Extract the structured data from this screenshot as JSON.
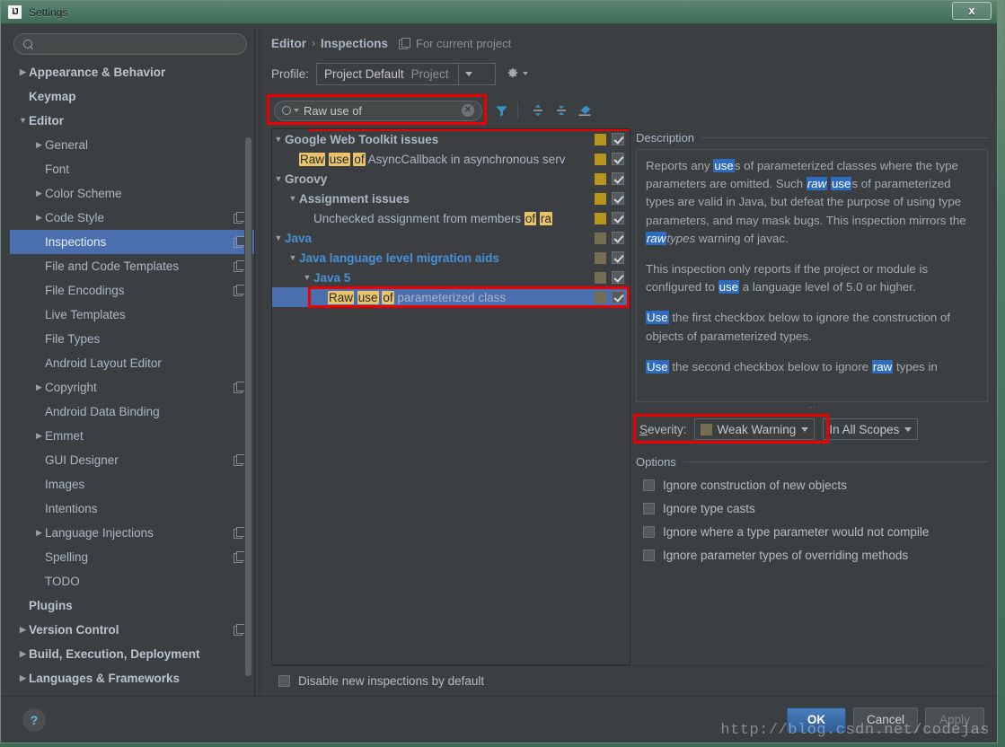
{
  "window": {
    "title": "Settings",
    "app_icon": "intellij-idea-icon",
    "close_label": "x"
  },
  "sidebar": {
    "search": {
      "placeholder": "",
      "value": "",
      "icon": "search-icon"
    },
    "items": [
      {
        "label": "Appearance & Behavior",
        "indent": 0,
        "arrow": "collapsed",
        "bold": true,
        "badge": false,
        "selected": false
      },
      {
        "label": "Keymap",
        "indent": 0,
        "arrow": "none",
        "bold": true,
        "badge": false,
        "selected": false
      },
      {
        "label": "Editor",
        "indent": 0,
        "arrow": "expanded",
        "bold": true,
        "badge": false,
        "selected": false
      },
      {
        "label": "General",
        "indent": 1,
        "arrow": "collapsed",
        "bold": false,
        "badge": false,
        "selected": false
      },
      {
        "label": "Font",
        "indent": 1,
        "arrow": "none",
        "bold": false,
        "badge": false,
        "selected": false
      },
      {
        "label": "Color Scheme",
        "indent": 1,
        "arrow": "collapsed",
        "bold": false,
        "badge": false,
        "selected": false
      },
      {
        "label": "Code Style",
        "indent": 1,
        "arrow": "collapsed",
        "bold": false,
        "badge": true,
        "selected": false
      },
      {
        "label": "Inspections",
        "indent": 1,
        "arrow": "none",
        "bold": false,
        "badge": true,
        "selected": true
      },
      {
        "label": "File and Code Templates",
        "indent": 1,
        "arrow": "none",
        "bold": false,
        "badge": true,
        "selected": false
      },
      {
        "label": "File Encodings",
        "indent": 1,
        "arrow": "none",
        "bold": false,
        "badge": true,
        "selected": false
      },
      {
        "label": "Live Templates",
        "indent": 1,
        "arrow": "none",
        "bold": false,
        "badge": false,
        "selected": false
      },
      {
        "label": "File Types",
        "indent": 1,
        "arrow": "none",
        "bold": false,
        "badge": false,
        "selected": false
      },
      {
        "label": "Android Layout Editor",
        "indent": 1,
        "arrow": "none",
        "bold": false,
        "badge": false,
        "selected": false
      },
      {
        "label": "Copyright",
        "indent": 1,
        "arrow": "collapsed",
        "bold": false,
        "badge": true,
        "selected": false
      },
      {
        "label": "Android Data Binding",
        "indent": 1,
        "arrow": "none",
        "bold": false,
        "badge": false,
        "selected": false
      },
      {
        "label": "Emmet",
        "indent": 1,
        "arrow": "collapsed",
        "bold": false,
        "badge": false,
        "selected": false
      },
      {
        "label": "GUI Designer",
        "indent": 1,
        "arrow": "none",
        "bold": false,
        "badge": true,
        "selected": false
      },
      {
        "label": "Images",
        "indent": 1,
        "arrow": "none",
        "bold": false,
        "badge": false,
        "selected": false
      },
      {
        "label": "Intentions",
        "indent": 1,
        "arrow": "none",
        "bold": false,
        "badge": false,
        "selected": false
      },
      {
        "label": "Language Injections",
        "indent": 1,
        "arrow": "collapsed",
        "bold": false,
        "badge": true,
        "selected": false
      },
      {
        "label": "Spelling",
        "indent": 1,
        "arrow": "none",
        "bold": false,
        "badge": true,
        "selected": false
      },
      {
        "label": "TODO",
        "indent": 1,
        "arrow": "none",
        "bold": false,
        "badge": false,
        "selected": false
      },
      {
        "label": "Plugins",
        "indent": 0,
        "arrow": "none",
        "bold": true,
        "badge": false,
        "selected": false
      },
      {
        "label": "Version Control",
        "indent": 0,
        "arrow": "collapsed",
        "bold": true,
        "badge": true,
        "selected": false
      },
      {
        "label": "Build, Execution, Deployment",
        "indent": 0,
        "arrow": "collapsed",
        "bold": true,
        "badge": false,
        "selected": false
      },
      {
        "label": "Languages & Frameworks",
        "indent": 0,
        "arrow": "collapsed",
        "bold": true,
        "badge": false,
        "selected": false
      }
    ]
  },
  "main": {
    "breadcrumb": {
      "root": "Editor",
      "separator": "›",
      "leaf": "Inspections"
    },
    "scope_note": "For current project",
    "profile": {
      "label": "Profile:",
      "value": "Project Default",
      "suffix": "Project",
      "gear_icon": "gear-icon"
    },
    "toolbar": {
      "search_value": "Raw use of",
      "search_icon": "search-icon",
      "clear_icon": "clear-x-icon",
      "filter_icon": "filter-funnel-icon",
      "expand_icon": "expand-all-icon",
      "collapse_icon": "collapse-all-icon",
      "reset_icon": "eraser-icon"
    },
    "tree": [
      {
        "indent": 0,
        "arrow": "expanded",
        "style": "group",
        "parts": [
          {
            "t": "Google Web Toolkit issues",
            "h": false
          }
        ],
        "severity": "#b8941f",
        "checked": true,
        "selected": false
      },
      {
        "indent": 1,
        "arrow": "none",
        "style": "plain",
        "parts": [
          {
            "t": "Raw",
            "h": true
          },
          {
            "t": " ",
            "h": false
          },
          {
            "t": "use",
            "h": true
          },
          {
            "t": " ",
            "h": false
          },
          {
            "t": "of",
            "h": true
          },
          {
            "t": " AsyncCallback in asynchronous serv",
            "h": false
          }
        ],
        "severity": "#b8941f",
        "checked": true,
        "selected": false
      },
      {
        "indent": 0,
        "arrow": "expanded",
        "style": "group",
        "parts": [
          {
            "t": "Groovy",
            "h": false
          }
        ],
        "severity": "#b8941f",
        "checked": true,
        "selected": false
      },
      {
        "indent": 1,
        "arrow": "expanded",
        "style": "group",
        "parts": [
          {
            "t": "Assignment issues",
            "h": false
          }
        ],
        "severity": "#b8941f",
        "checked": true,
        "selected": false
      },
      {
        "indent": 2,
        "arrow": "none",
        "style": "plain",
        "parts": [
          {
            "t": "Unchecked assignment from members ",
            "h": false
          },
          {
            "t": "of",
            "h": true
          },
          {
            "t": " ",
            "h": false
          },
          {
            "t": "ra",
            "h": true
          }
        ],
        "severity": "#b8941f",
        "checked": true,
        "selected": false
      },
      {
        "indent": 0,
        "arrow": "expanded",
        "style": "blue",
        "parts": [
          {
            "t": "Java",
            "h": false
          }
        ],
        "severity": "#766e52",
        "checked": true,
        "selected": false
      },
      {
        "indent": 1,
        "arrow": "expanded",
        "style": "blue",
        "parts": [
          {
            "t": "Java language level migration aids",
            "h": false
          }
        ],
        "severity": "#766e52",
        "checked": true,
        "selected": false
      },
      {
        "indent": 2,
        "arrow": "expanded",
        "style": "blue",
        "parts": [
          {
            "t": "Java 5",
            "h": false
          }
        ],
        "severity": "#766e52",
        "checked": true,
        "selected": false
      },
      {
        "indent": 3,
        "arrow": "none",
        "style": "plain",
        "parts": [
          {
            "t": "Raw",
            "h": true
          },
          {
            "t": " ",
            "h": false
          },
          {
            "t": "use",
            "h": true
          },
          {
            "t": " ",
            "h": false
          },
          {
            "t": "of",
            "h": true
          },
          {
            "t": " parameterized class",
            "h": false
          }
        ],
        "severity": "#766e52",
        "checked": true,
        "selected": true
      }
    ],
    "description": {
      "title": "Description",
      "paragraphs": [
        [
          {
            "t": "Reports any ",
            "s": "normal"
          },
          {
            "t": "use",
            "s": "mark"
          },
          {
            "t": "s of parameterized classes where the type parameters are omitted. Such ",
            "s": "normal"
          },
          {
            "t": "raw",
            "s": "mark-italic"
          },
          {
            "t": " ",
            "s": "normal"
          },
          {
            "t": "use",
            "s": "mark"
          },
          {
            "t": "s of parameterized types are valid in Java, but defeat the purpose of using type parameters, and may mask bugs. This inspection mirrors the ",
            "s": "normal"
          },
          {
            "t": "raw",
            "s": "mark-italic"
          },
          {
            "t": "types",
            "s": "italic"
          },
          {
            "t": " warning of javac.",
            "s": "normal"
          }
        ],
        [
          {
            "t": "This inspection only reports if the project or module is configured to ",
            "s": "normal"
          },
          {
            "t": "use",
            "s": "mark"
          },
          {
            "t": " a language level of 5.0 or higher.",
            "s": "normal"
          }
        ],
        [
          {
            "t": "Use",
            "s": "mark"
          },
          {
            "t": " the first checkbox below to ignore the construction of objects of parameterized types.",
            "s": "normal"
          }
        ],
        [
          {
            "t": "Use",
            "s": "mark"
          },
          {
            "t": " the second checkbox below to ignore ",
            "s": "normal"
          },
          {
            "t": "raw",
            "s": "mark"
          },
          {
            "t": " types in",
            "s": "normal"
          }
        ]
      ]
    },
    "severity": {
      "label": "Severity:",
      "value": "Weak Warning",
      "swatch_color": "#766e52",
      "scope_value": "In All Scopes"
    },
    "options": {
      "title": "Options",
      "items": [
        {
          "label": "Ignore construction of new objects",
          "checked": false
        },
        {
          "label": "Ignore type casts",
          "checked": false
        },
        {
          "label": "Ignore where a type parameter would not compile",
          "checked": false
        },
        {
          "label": "Ignore parameter types of overriding methods",
          "checked": false
        }
      ]
    },
    "disable_new": {
      "label": "Disable new inspections by default",
      "checked": false
    }
  },
  "footer": {
    "help_label": "?",
    "ok_label": "OK",
    "cancel_label": "Cancel",
    "apply_label": "Apply",
    "watermark": "http://blog.csdn.net/codejas"
  }
}
